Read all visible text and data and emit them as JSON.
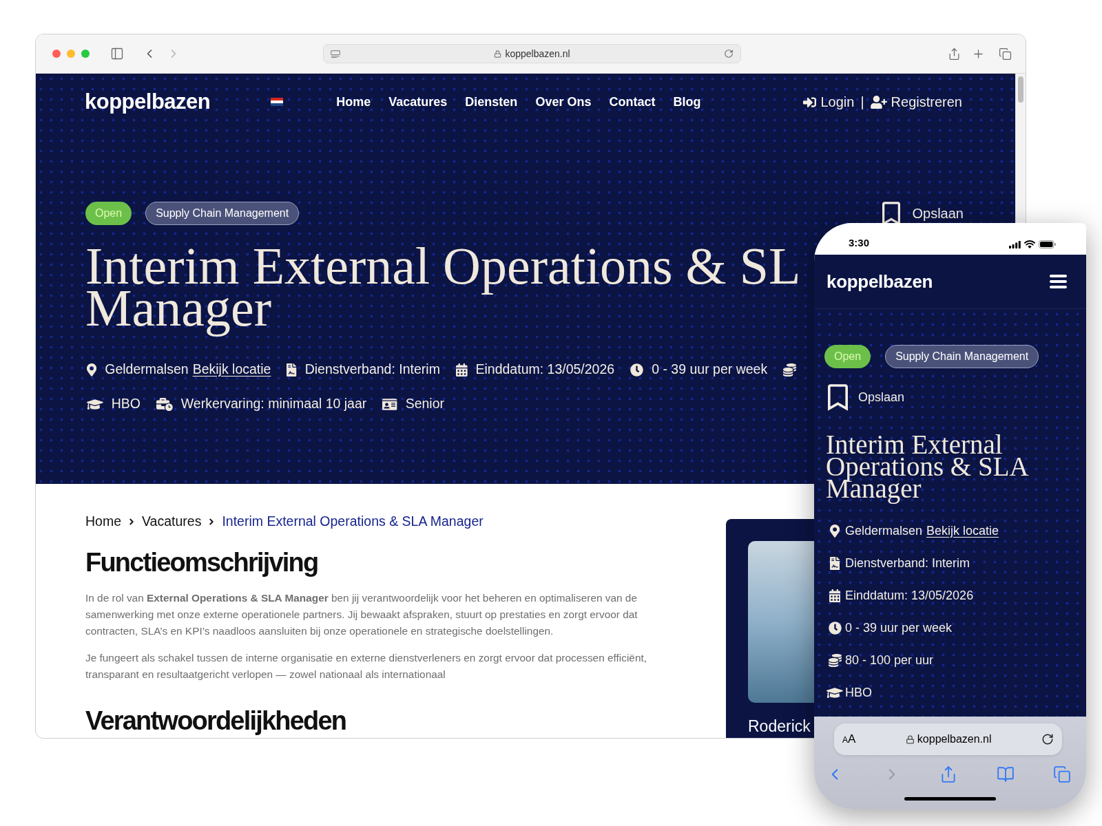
{
  "desktop": {
    "address_bar": {
      "url": "koppelbazen.nl"
    },
    "header": {
      "logo": "koppelbazen",
      "nav": [
        {
          "label": "Home"
        },
        {
          "label": "Vacatures"
        },
        {
          "label": "Diensten"
        },
        {
          "label": "Over Ons"
        },
        {
          "label": "Contact"
        },
        {
          "label": "Blog"
        }
      ],
      "login": "Login",
      "divider": "|",
      "register": "Registreren"
    },
    "hero": {
      "tags": [
        {
          "label": "Open",
          "kind": "status"
        },
        {
          "label": "Supply Chain Management",
          "kind": "category"
        }
      ],
      "save": "Opslaan",
      "title_lines": [
        "Interim External Operations & SL",
        "Manager"
      ],
      "meta_rows": [
        {
          "items": [
            {
              "text": "Geldermalsen",
              "link": "Bekijk locatie"
            },
            {
              "text": "Dienstverband: Interim"
            },
            {
              "text": "Einddatum: 13/05/2026"
            },
            {
              "text": "0 - 39 uur per week"
            }
          ]
        },
        {
          "items": [
            {
              "text": "HBO"
            },
            {
              "text": "Werkervaring: minimaal 10 jaar"
            },
            {
              "text": "Senior"
            }
          ]
        }
      ]
    },
    "breadcrumb": [
      {
        "label": "Home",
        "current": false
      },
      {
        "label": "Vacatures",
        "current": false
      },
      {
        "label": "Interim External Operations & SLA Manager",
        "current": true
      }
    ],
    "sections": [
      {
        "heading": "Functieomschrijving",
        "paragraphs": [
          "In de rol van **External Operations & SLA Manager** ben jij verantwoordelijk voor het beheren en optimaliseren van de samenwerking met onze externe operationele partners. Jij bewaakt afspraken, stuurt op prestaties en zorgt ervoor dat contracten, SLA’s en KPI’s naadloos aansluiten bij onze operationele en strategische doelstellingen.",
          "Je fungeert als schakel tussen de interne organisatie en externe dienstverleners en zorgt ervoor dat processen efficiënt, transparant en resultaatgericht verlopen — zowel nationaal als internationaal"
        ]
      },
      {
        "heading": "Verantwoordelijkheden"
      }
    ],
    "contact_card": {
      "name": "Roderick"
    }
  },
  "phone": {
    "status_bar": {
      "time": "3:30"
    },
    "header": {
      "logo": "koppelbazen"
    },
    "tags": [
      {
        "label": "Open",
        "kind": "status"
      },
      {
        "label": "Supply Chain Management",
        "kind": "category"
      }
    ],
    "save": "Opslaan",
    "title": "Interim External Operations & SLA Manager",
    "meta": [
      {
        "text": "Geldermalsen",
        "link": "Bekijk locatie"
      },
      {
        "text": "Dienstverband: Interim"
      },
      {
        "text": "Einddatum: 13/05/2026"
      },
      {
        "text": "0 - 39 uur per week"
      },
      {
        "text": "80 - 100 per uur"
      },
      {
        "text": "HBO"
      }
    ],
    "address_bar": {
      "text_size": "AA",
      "url": "koppelbazen.nl"
    }
  }
}
